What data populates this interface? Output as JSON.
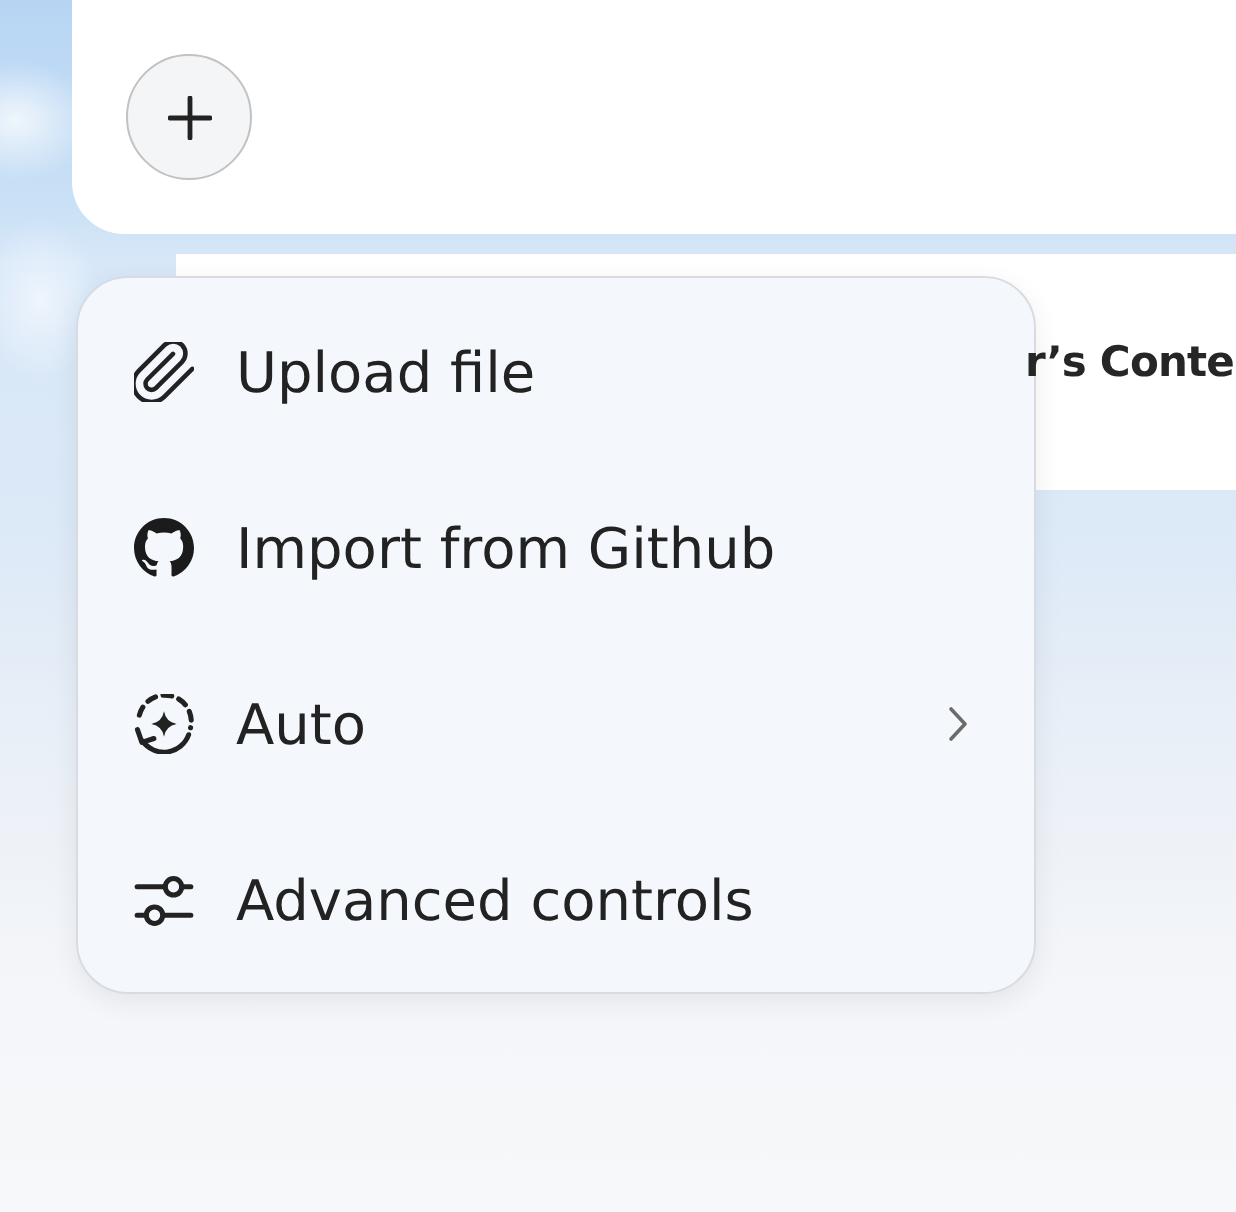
{
  "content_card": {
    "title": "r’s Conte"
  },
  "menu": {
    "items": [
      {
        "label": "Upload file",
        "has_submenu": false
      },
      {
        "label": "Import from Github",
        "has_submenu": false
      },
      {
        "label": "Auto",
        "has_submenu": true
      },
      {
        "label": "Advanced controls",
        "has_submenu": false
      }
    ]
  }
}
